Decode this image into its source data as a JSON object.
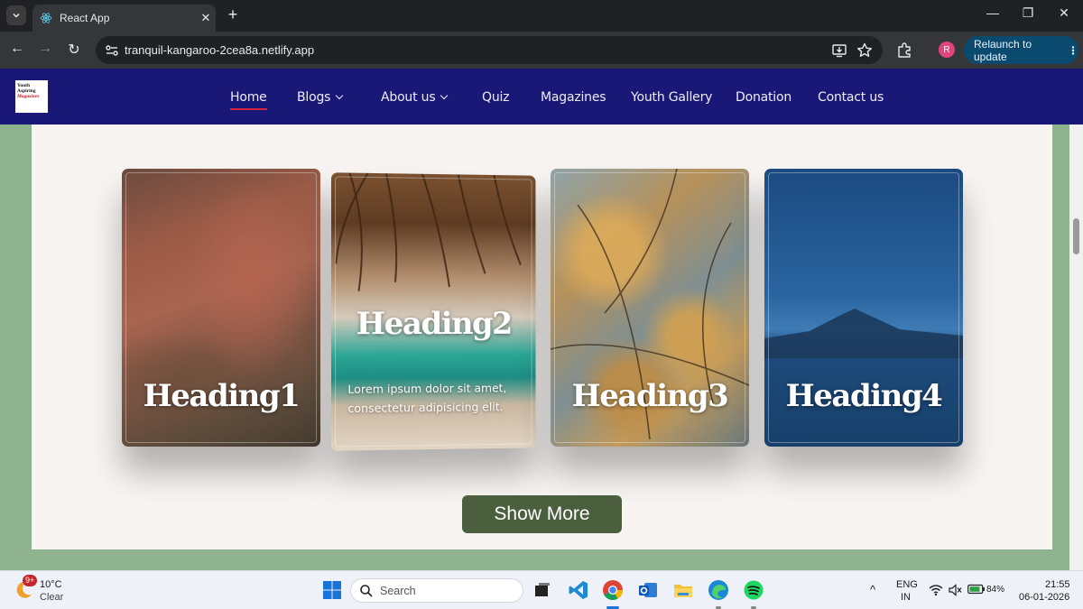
{
  "browser": {
    "tab_title": "React App",
    "tab_close": "✕",
    "new_tab": "+",
    "url": "tranquil-kangaroo-2cea8a.netlify.app",
    "profile_initial": "R",
    "relaunch_label": "Relaunch to update",
    "relaunch_dots": "⋮",
    "window_controls": {
      "minimize": "—",
      "restore": "❐",
      "close": "✕"
    },
    "nav": {
      "back": "←",
      "forward": "→",
      "reload": "↻"
    }
  },
  "site": {
    "logo_lines": [
      "Youth",
      "Aspiring",
      "Magazines"
    ],
    "nav_items": [
      "Home",
      "Blogs",
      "About us",
      "Quiz",
      "Magazines",
      "Youth Gallery",
      "Donation",
      "Contact us"
    ],
    "cards": [
      {
        "heading": "Heading1"
      },
      {
        "heading": "Heading2",
        "text": "Lorem ipsum dolor sit amet, consectetur adipisicing elit."
      },
      {
        "heading": "Heading3"
      },
      {
        "heading": "Heading4"
      }
    ],
    "show_more_label": "Show More"
  },
  "taskbar": {
    "weather_badge": "9+",
    "weather_temp": "10°C",
    "weather_condition": "Clear",
    "search_placeholder": "Search",
    "language_line1": "ENG",
    "language_line2": "IN",
    "battery": "84%",
    "time": "21:55",
    "date": "06-01-2026",
    "chevron": "^"
  },
  "colors": {
    "site_nav": "#1a1877",
    "page_background": "#8fb38e",
    "panel": "#f7f4f2",
    "show_more": "#4b5f3f",
    "active_underline": "#e2283a",
    "relaunch": "#0b4a6f"
  },
  "icons": [
    "tab-search-icon",
    "react-favicon-icon",
    "site-info-icon",
    "install-app-icon",
    "star-icon",
    "extensions-icon",
    "windows-start-icon",
    "search-icon",
    "task-view-icon",
    "vscode-icon",
    "chrome-icon",
    "outlook-icon",
    "file-explorer-icon",
    "edge-icon",
    "spotify-icon",
    "wifi-icon",
    "volume-muted-icon",
    "battery-icon",
    "weather-icon"
  ]
}
